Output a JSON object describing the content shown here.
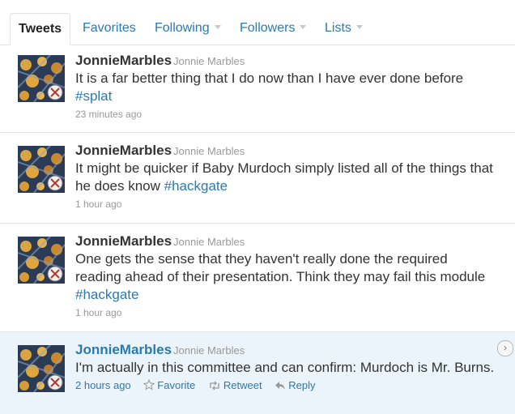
{
  "tabs": [
    {
      "label": "Tweets"
    },
    {
      "label": "Favorites"
    },
    {
      "label": "Following"
    },
    {
      "label": "Followers"
    },
    {
      "label": "Lists"
    }
  ],
  "tweets": [
    {
      "username": "JonnieMarbles",
      "realname": "Jonnie Marbles",
      "text": "It is a far better thing that I do now than I have ever done before ",
      "hashtag": "#splat",
      "time": "23 minutes ago"
    },
    {
      "username": "JonnieMarbles",
      "realname": "Jonnie Marbles",
      "text": "It might be quicker if Baby Murdoch simply listed all of the things that he does know ",
      "hashtag": "#hackgate",
      "time": "1 hour ago"
    },
    {
      "username": "JonnieMarbles",
      "realname": "Jonnie Marbles",
      "text": "One gets the sense that they haven't really done the required reading ahead of their presentation. Think they may fail this module ",
      "hashtag": "#hackgate",
      "time": "1 hour ago"
    },
    {
      "username": "JonnieMarbles",
      "realname": "Jonnie Marbles",
      "text": "I'm actually in this committee and can confirm: Murdoch is Mr. Burns.",
      "hashtag": "",
      "time": "2 hours ago"
    }
  ],
  "actions": {
    "favorite": "Favorite",
    "retweet": "Retweet",
    "reply": "Reply"
  },
  "colors": {
    "link": "#2a7ab0",
    "hover_bg": "#ebf4fb"
  }
}
